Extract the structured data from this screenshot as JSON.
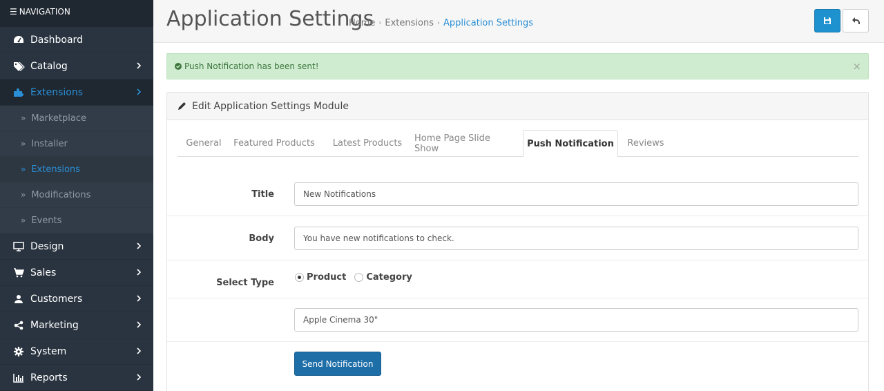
{
  "nav": {
    "header": "NAVIGATION",
    "items": [
      {
        "label": "Dashboard",
        "icon": "dashboard-icon"
      },
      {
        "label": "Catalog",
        "icon": "tags-icon"
      },
      {
        "label": "Extensions",
        "icon": "puzzle-icon"
      },
      {
        "label": "Design",
        "icon": "monitor-icon"
      },
      {
        "label": "Sales",
        "icon": "cart-icon"
      },
      {
        "label": "Customers",
        "icon": "user-icon"
      },
      {
        "label": "Marketing",
        "icon": "share-icon"
      },
      {
        "label": "System",
        "icon": "gear-icon"
      },
      {
        "label": "Reports",
        "icon": "bar-chart-icon"
      }
    ],
    "extensions_sub": [
      "Marketplace",
      "Installer",
      "Extensions",
      "Modifications",
      "Events"
    ],
    "active_item": "Extensions",
    "active_sub": "Extensions"
  },
  "header": {
    "title": "Application Settings",
    "breadcrumb": [
      "Home",
      "Extensions",
      "Application Settings"
    ]
  },
  "alert": {
    "message": "Push Notification has been sent!",
    "close": "×"
  },
  "panel": {
    "heading": "Edit Application Settings Module",
    "tabs": [
      "General",
      "Featured Products",
      "Latest Products",
      "Home Page Slide Show",
      "Push Notification",
      "Reviews"
    ],
    "active_tab": "Push Notification"
  },
  "form": {
    "title_label": "Title",
    "title_value": "New Notifications",
    "body_label": "Body",
    "body_value": "You have new notifications to check.",
    "type_label": "Select Type",
    "type_options": [
      "Product",
      "Category"
    ],
    "type_selected": "Product",
    "product_value": "Apple Cinema 30\"",
    "send_button": "Send Notification"
  },
  "colors": {
    "sidebar_bg": "#2a3440",
    "accent": "#1e91cf",
    "active_link": "#2a8fd6",
    "alert_bg": "#d0ecd0",
    "send_button": "#1e6ea8"
  }
}
